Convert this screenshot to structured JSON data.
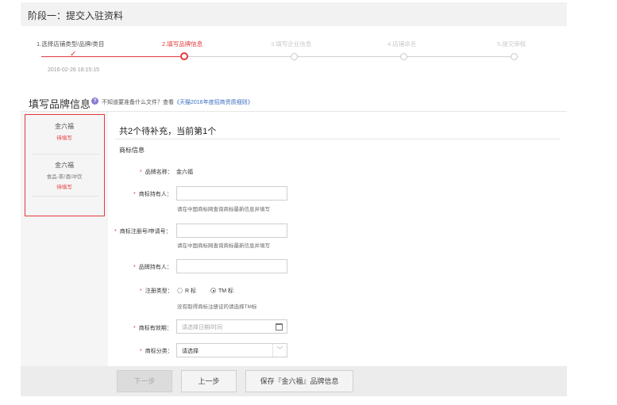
{
  "header": {
    "title": "阶段一：提交入驻资料"
  },
  "steps": [
    {
      "label": "1.选择店铺类型/品牌/类目",
      "state": "done"
    },
    {
      "label": "2.填写品牌信息",
      "state": "current"
    },
    {
      "label": "3.填写企业信息",
      "state": "pending"
    },
    {
      "label": "4.店铺命名",
      "state": "pending"
    },
    {
      "label": "5.提交审核",
      "state": "pending"
    }
  ],
  "step_time": "2016-02-26 18:15:15",
  "section": {
    "title": "填写品牌信息",
    "help_icon": "question-icon",
    "help_text": "不知道要准备什么文件？查看",
    "help_link": "《天猫2016年度招商资质细则》"
  },
  "sidebar": {
    "brands": [
      {
        "name": "金六福",
        "category": "",
        "status": "待填写"
      },
      {
        "name": "金六福",
        "category": "食品-茶/酒/冲饮",
        "status": "待填写"
      }
    ]
  },
  "main": {
    "progress": "共2个待补充，当前第1个",
    "subsection": "商标信息",
    "fields": {
      "brand_name": {
        "label": "品牌名称：",
        "value": "金六福"
      },
      "tm_holder": {
        "label": "商标持有人：",
        "value": "",
        "hint": "请在中国商标网查询商标最新信息并填写"
      },
      "tm_reg_no": {
        "label": "商标注册号/申请号：",
        "value": "",
        "hint": "请在中国商标网查询商标最新信息并填写"
      },
      "brand_holder": {
        "label": "品牌持有人：",
        "value": ""
      },
      "reg_type": {
        "label": "注册类型：",
        "options": [
          "R 标",
          "TM 标"
        ],
        "selected": "TM 标",
        "hint": "没有取得商标注册证的请选择TM标"
      },
      "validity": {
        "label": "商标有效期：",
        "placeholder": "请选择日期/时间",
        "icon": "calendar-icon"
      },
      "category": {
        "label": "商标分类：",
        "value": "请选择",
        "icon": "chevron-down-icon"
      }
    }
  },
  "footer": {
    "next_label": "下一步",
    "prev_label": "上一步",
    "save_label": "保存『金六福』品牌信息"
  },
  "colors": {
    "accent": "#e4393c",
    "link": "#3b6ec2",
    "help_icon": "#8c7ad1"
  }
}
